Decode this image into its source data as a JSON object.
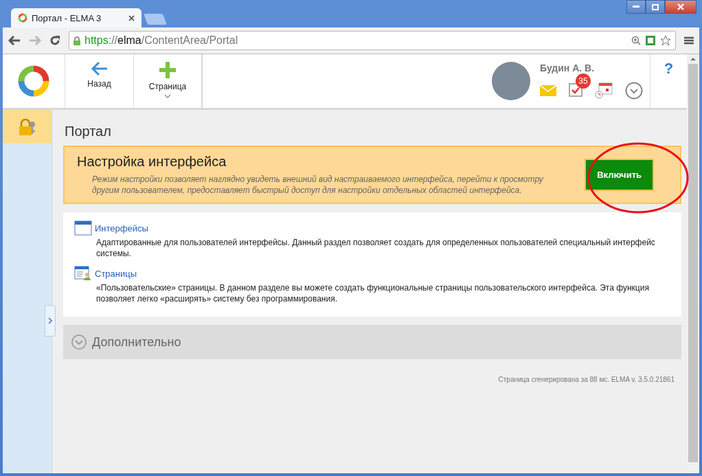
{
  "window": {
    "tab_title": "Портал - ELMA 3"
  },
  "address_bar": {
    "url_parts": [
      {
        "text": "https",
        "kind": "scheme"
      },
      {
        "text": "://",
        "kind": "sep"
      },
      {
        "text": "elma",
        "kind": "host"
      },
      {
        "text": "/ContentArea/Portal",
        "kind": "path"
      }
    ]
  },
  "toolbar": [
    {
      "label": "Назад",
      "kind": "back",
      "dropdown": false
    },
    {
      "label": "Страница",
      "kind": "add",
      "dropdown": true
    }
  ],
  "user": {
    "name": "Будин А. В.",
    "tasks_badge": "35"
  },
  "help": "?",
  "page_title": "Портал",
  "banner": {
    "title": "Настройка интерфейса",
    "description": "Режим настройки позволяет наглядно увидеть внешний вид настраиваемого интерфейса, перейти к просмотру другим пользователем, предоставляет быстрый доступ для настройки отдельных областей интерфейса.",
    "button": "Включить"
  },
  "sections": [
    {
      "kind": "interfaces",
      "title": "Интерфейсы",
      "description": "Адаптированные для пользователей интерфейсы. Данный раздел позволяет создать для определенных пользователей специальный интерфейс системы."
    },
    {
      "kind": "pages",
      "title": "Страницы",
      "description": "«Пользовательские» страницы. В данном разделе вы можете создать функциональные страницы пользовательского интерфейса. Эта функция позволяет легко «расширять» систему без программирования."
    }
  ],
  "more": {
    "label": "Дополнительно",
    "expanded": false
  },
  "footer": "Страница сгенерирована за 88 мс. ELMA v. 3.5.0.21861"
}
